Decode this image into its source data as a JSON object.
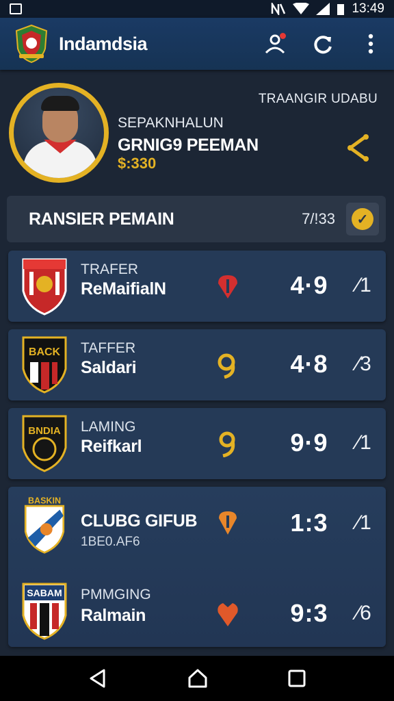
{
  "status_bar": {
    "time": "13:49"
  },
  "app": {
    "title": "Indamdsia"
  },
  "profile": {
    "top_tag": "TRAANGIR UDABU",
    "label": "SEPAKNHALUN",
    "name": "GRNIG9 PEEMAN",
    "value": "$:330"
  },
  "section": {
    "title": "RANSIER PEMAIN",
    "count": "7/!33"
  },
  "cards": [
    {
      "crest_text": "",
      "label": "TRAFER",
      "name": "ReMaifialN",
      "sub": "",
      "badge_color": "#d32f2f",
      "score": "4·9",
      "trend": "⁄1"
    },
    {
      "crest_text": "BACK",
      "label": "TAFFER",
      "name": "Saldari",
      "sub": "",
      "badge_color": "#e4b224",
      "score": "4·8",
      "trend": "⁄3"
    },
    {
      "crest_text": "BNDIA",
      "label": "LAMING",
      "name": "Reifkarl",
      "sub": "",
      "badge_color": "#e4b224",
      "score": "9·9",
      "trend": "⁄1"
    },
    {
      "crest_text": "BASKIN",
      "label": "",
      "name": "CLUBG GIFUB",
      "sub": "1BE0.AF6",
      "badge_color": "#e8862a",
      "score": "1:3",
      "trend": "⁄1"
    },
    {
      "crest_text": "SABAM",
      "label": "PMMGING",
      "name": "Ralmain",
      "sub": "",
      "badge_color": "#e0592a",
      "score": "9:3",
      "trend": "⁄6"
    }
  ],
  "colors": {
    "accent": "#e4b224",
    "appbar": "#1a3a64",
    "background": "#1c2635",
    "card": "#253a57"
  },
  "icons": {
    "appbar": [
      "people-notification-icon",
      "refresh-icon",
      "more-vert-icon"
    ],
    "nav": [
      "back-icon",
      "home-icon",
      "recents-icon"
    ]
  }
}
